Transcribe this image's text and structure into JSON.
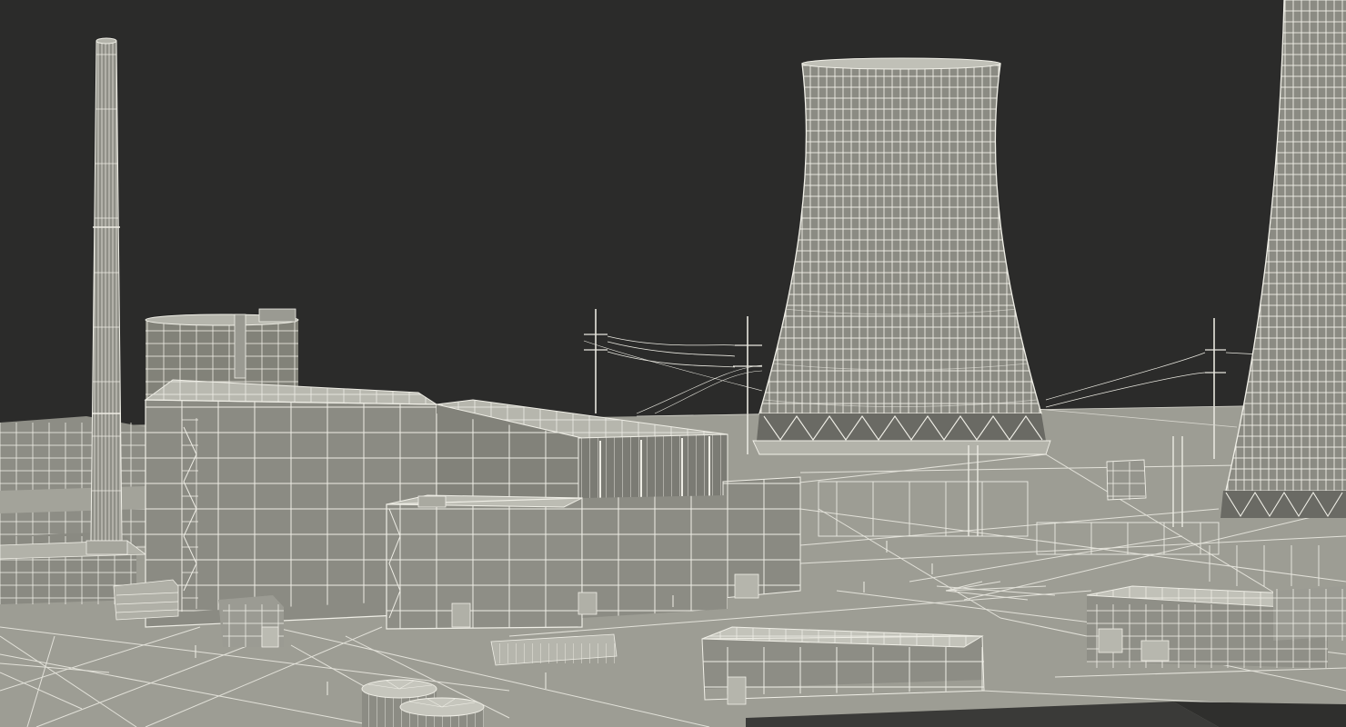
{
  "scene": {
    "kind": "3d-wireframe-render",
    "subject": "nuclear-power-plant",
    "colors": {
      "background": "#2b2b2a",
      "surface_light": "#a9a99f",
      "surface_mid": "#8f8f86",
      "surface_dark": "#6f6f69",
      "ground": "#9c9c93",
      "wire": "#f2f1ea"
    },
    "objects": [
      "exhaust-stack",
      "containment-cylinder",
      "reactor-building",
      "turbine-hall",
      "cooling-tower",
      "cooling-tower-partial",
      "power-pylons",
      "switchyard",
      "storage-tanks",
      "auxiliary-buildings"
    ]
  }
}
